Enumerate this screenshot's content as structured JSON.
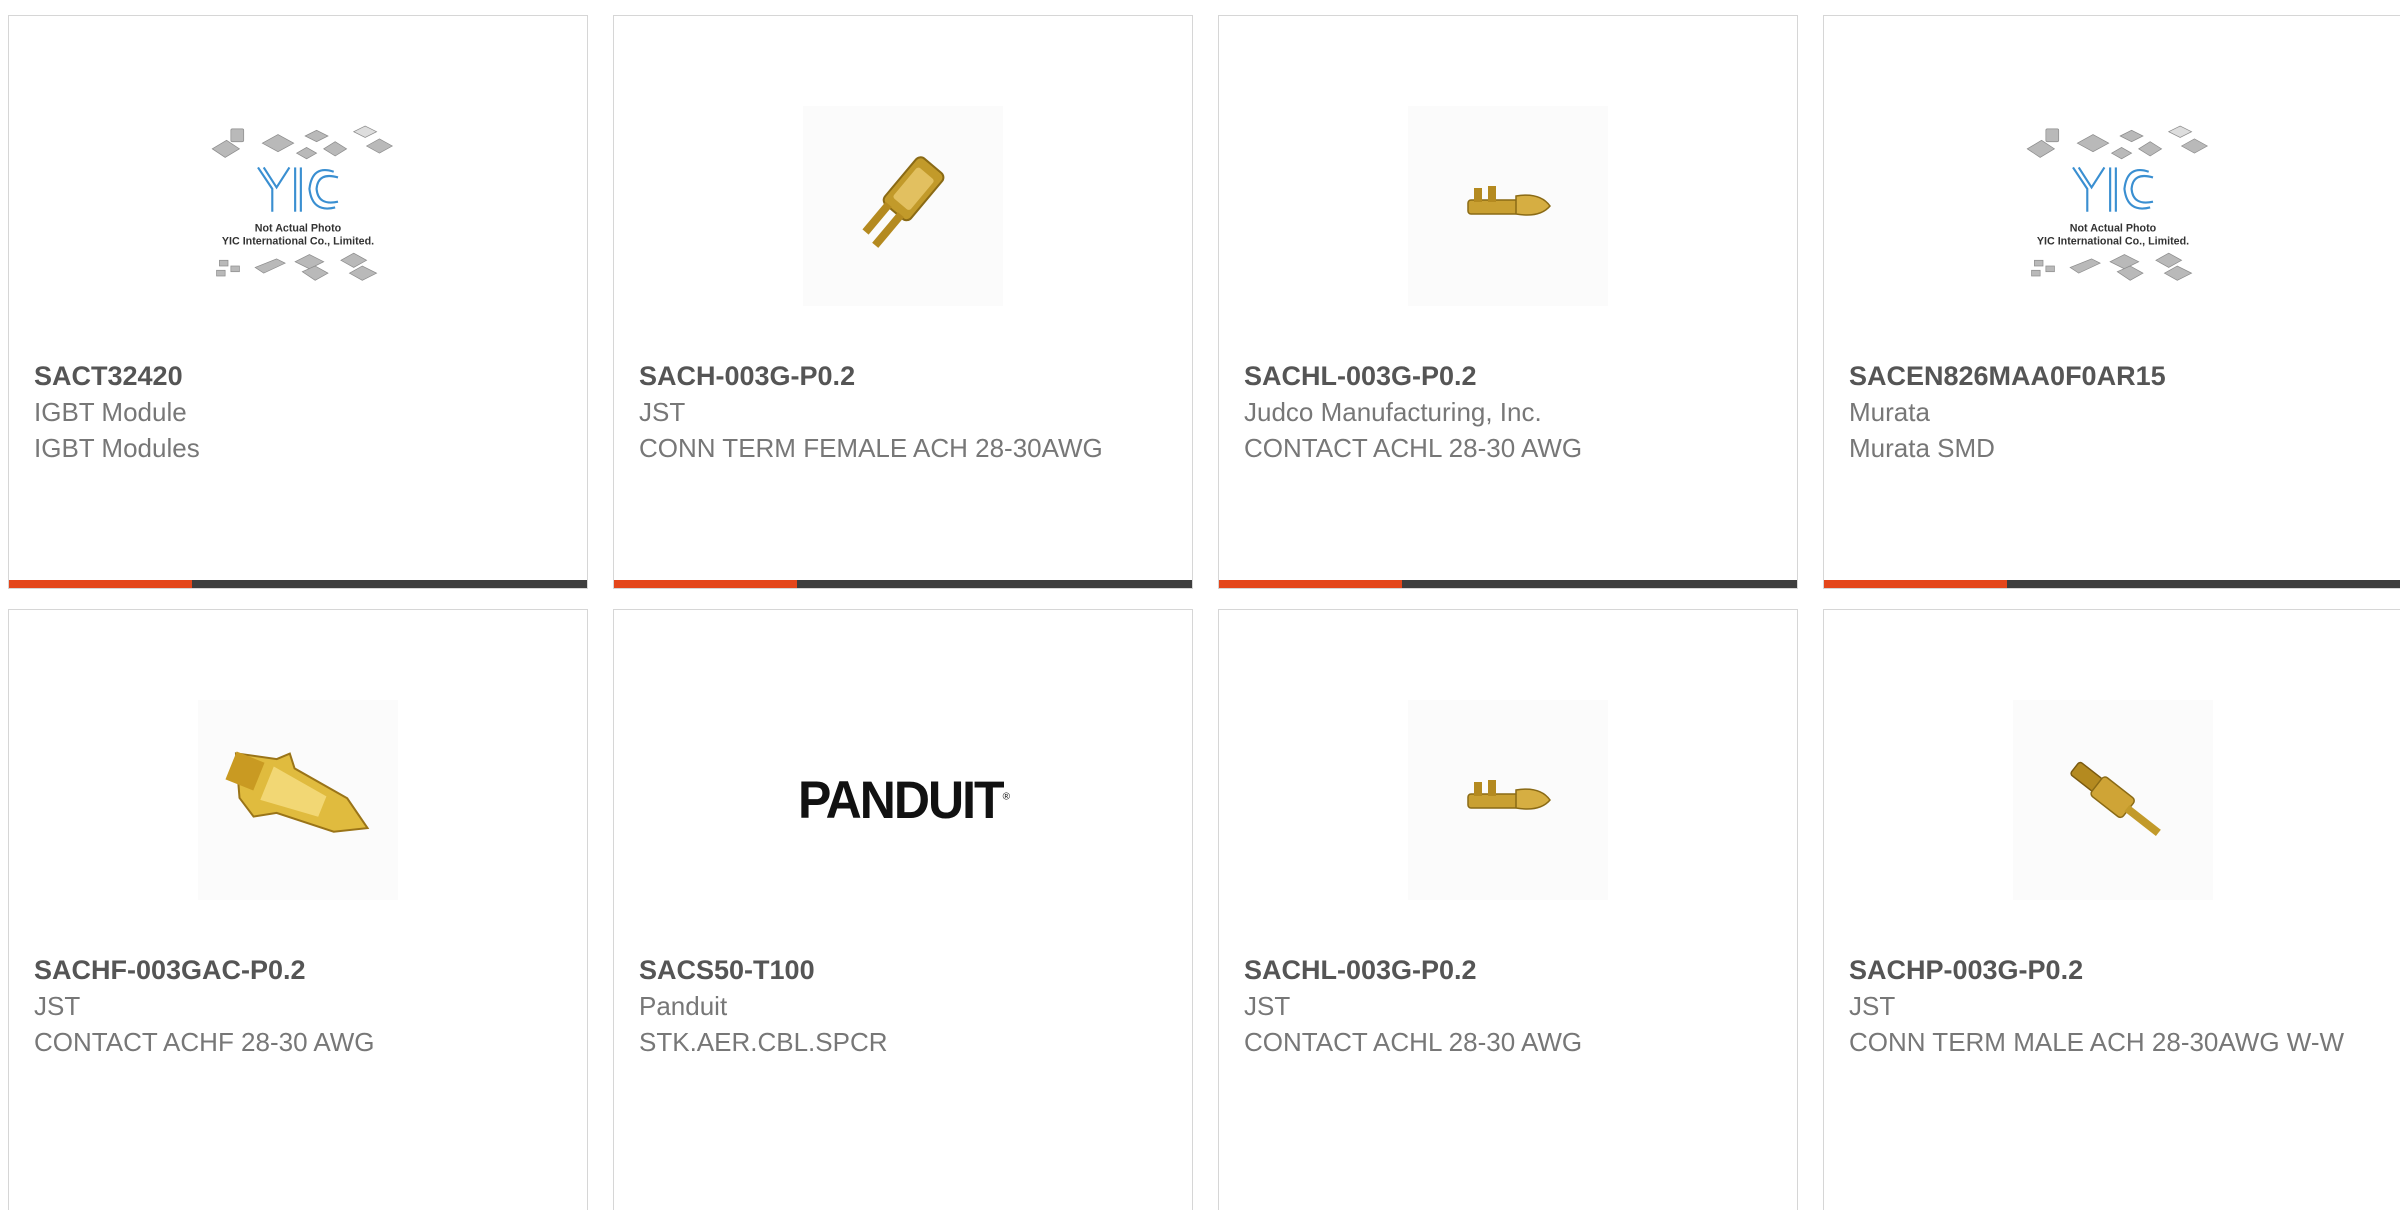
{
  "brand_colors": {
    "accent": "#e4461b",
    "bar": "#3d3d3d",
    "part_text": "#555555",
    "body_text": "#777777",
    "border": "#d6d6d6"
  },
  "placeholder": {
    "line1": "Not Actual Photo",
    "line2": "YIC International Co., Limited.",
    "logo": "YIC"
  },
  "panduit_logo": "PANDUIT",
  "products": [
    {
      "part": "SACT32420",
      "maker": "IGBT Module",
      "desc": "IGBT Modules",
      "image": "yic-placeholder"
    },
    {
      "part": "SACH-003G-P0.2",
      "maker": "JST",
      "desc": "CONN TERM FEMALE ACH 28-30AWG",
      "image": "crimp-terminal-female"
    },
    {
      "part": "SACHL-003G-P0.2",
      "maker": "Judco Manufacturing, Inc.",
      "desc": "CONTACT ACHL 28-30 AWG",
      "image": "crimp-contact-small"
    },
    {
      "part": "SACEN826MAA0F0AR15",
      "maker": "Murata",
      "desc": "Murata SMD",
      "image": "yic-placeholder"
    },
    {
      "part": "SACHF-003GAC-P0.2",
      "maker": "JST",
      "desc": "CONTACT ACHF 28-30 AWG",
      "image": "crimp-contact-large"
    },
    {
      "part": "SACS50-T100",
      "maker": "Panduit",
      "desc": "STK.AER.CBL.SPCR",
      "image": "panduit-logo"
    },
    {
      "part": "SACHL-003G-P0.2",
      "maker": "JST",
      "desc": "CONTACT ACHL 28-30 AWG",
      "image": "crimp-contact-small"
    },
    {
      "part": "SACHP-003G-P0.2",
      "maker": "JST",
      "desc": "CONN TERM MALE ACH 28-30AWG W-W",
      "image": "crimp-terminal-male"
    }
  ]
}
